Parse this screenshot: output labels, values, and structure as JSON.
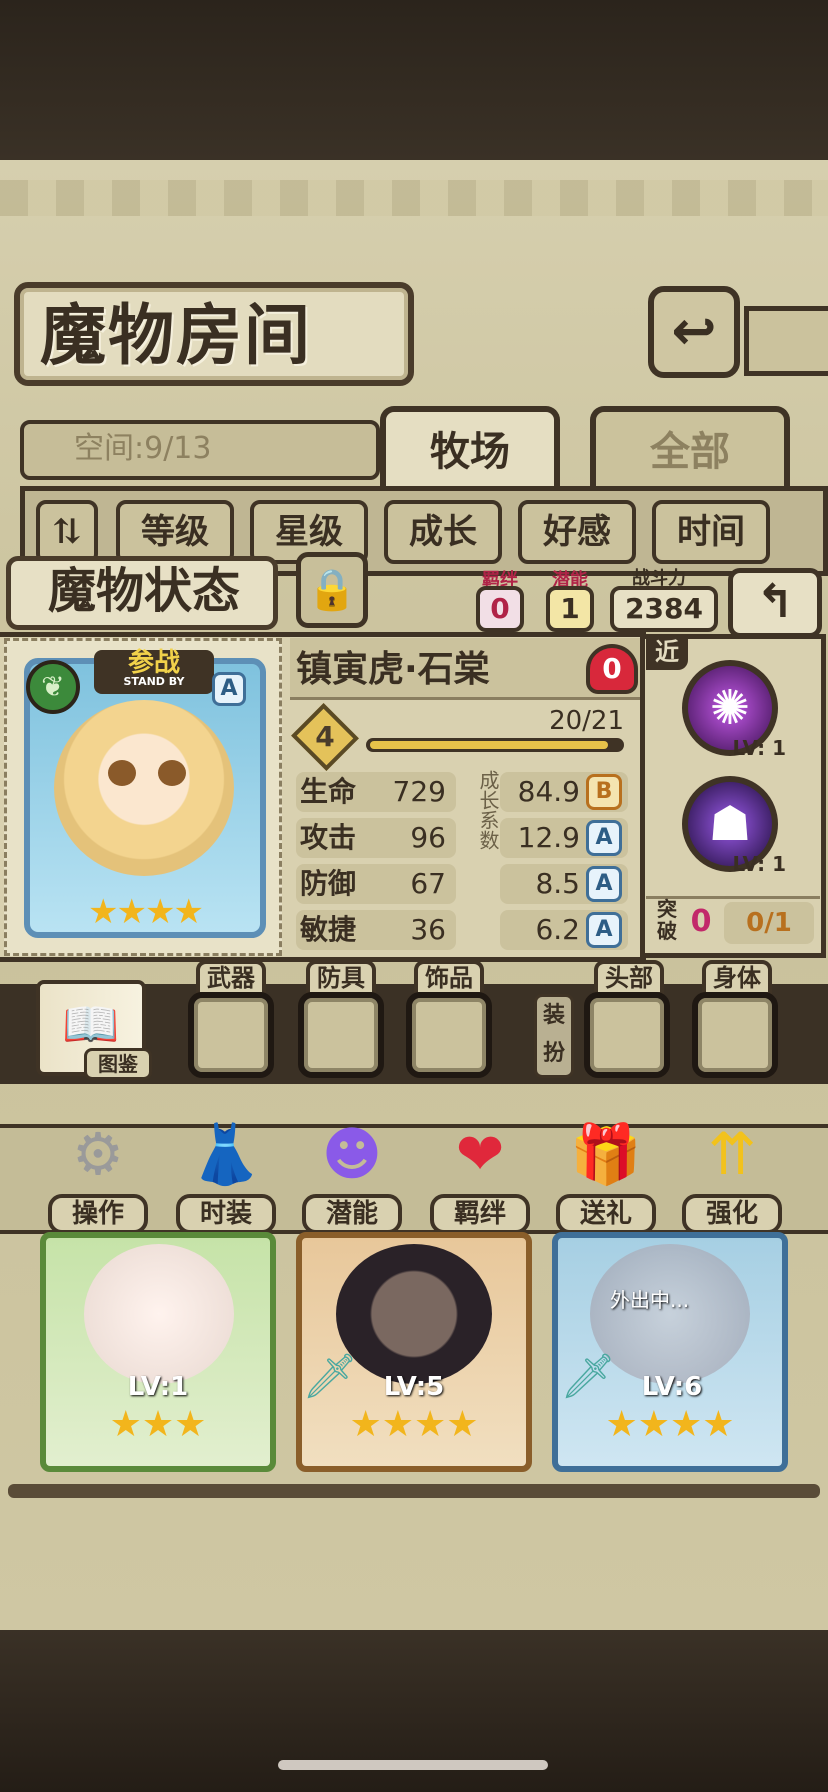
{
  "header": {
    "title": "魔物房间",
    "back_icon": "return-arrow-icon"
  },
  "room": {
    "space_label": "空间:9/13"
  },
  "tabs": [
    {
      "label": "牧场",
      "active": true
    },
    {
      "label": "全部",
      "active": false
    }
  ],
  "sort": {
    "order_icon": "sort-order-icon",
    "buttons": [
      "等级",
      "星级",
      "成长",
      "好感",
      "时间"
    ]
  },
  "status": {
    "title": "魔物状态",
    "lock_icon": "lock-icon",
    "bond": {
      "label": "羁绊",
      "value": "0"
    },
    "potential": {
      "label": "潜能",
      "value": "1"
    },
    "power": {
      "label": "战斗力",
      "value": "2384"
    },
    "back_icon": "back-arrow-icon"
  },
  "monster": {
    "name": "镇寅虎·石棠",
    "affection": "0",
    "level": "4",
    "exp_text": "20/21",
    "exp_fraction": 0.95,
    "standby_label": "参战",
    "standby_sub": "STAND BY",
    "element_icon": "leaf-icon",
    "rank": "A",
    "stars": "★★★★",
    "stats": [
      {
        "label": "生命",
        "value": "729",
        "growth": "84.9",
        "grade": "B"
      },
      {
        "label": "攻击",
        "value": "96",
        "growth": "12.9",
        "grade": "A"
      },
      {
        "label": "防御",
        "value": "67",
        "growth": "8.5",
        "grade": "A"
      },
      {
        "label": "敏捷",
        "value": "36",
        "growth": "6.2",
        "grade": "A"
      }
    ],
    "growth_label": "成长系数",
    "skill_type": "近",
    "skills": [
      {
        "icon": "vortex-skill-icon",
        "level": "LV: 1"
      },
      {
        "icon": "shadow-skill-icon",
        "level": "LV: 1"
      }
    ],
    "breakthrough": {
      "label": "突破",
      "value": "0",
      "progress": "0/1"
    }
  },
  "equipment": {
    "book_label": "图鉴",
    "slots": [
      "武器",
      "防具",
      "饰品"
    ],
    "dress_label": "装扮",
    "dress_slots": [
      "头部",
      "身体"
    ]
  },
  "actions": [
    {
      "label": "操作",
      "icon": "gear-icon"
    },
    {
      "label": "时装",
      "icon": "outfit-icon"
    },
    {
      "label": "潜能",
      "icon": "potential-icon"
    },
    {
      "label": "羁绊",
      "icon": "hearts-icon"
    },
    {
      "label": "送礼",
      "icon": "gift-icon"
    },
    {
      "label": "强化",
      "icon": "upgrade-arrows-icon"
    }
  ],
  "roster": [
    {
      "level": "LV:1",
      "stars": "★★★"
    },
    {
      "level": "LV:5",
      "stars": "★★★★"
    },
    {
      "level": "LV:6",
      "stars": "★★★★",
      "status": "外出中..."
    }
  ],
  "colors": {
    "gold": "#f2b51c",
    "parchment": "#d6cfae",
    "frame": "#3f3325"
  }
}
